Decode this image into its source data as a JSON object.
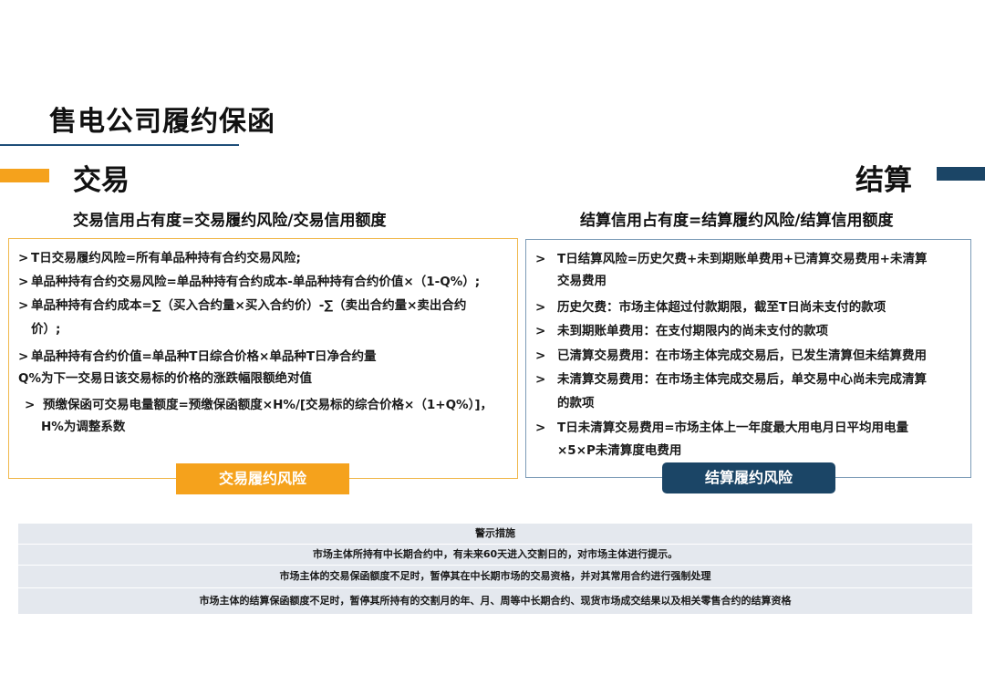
{
  "title": "售电公司履约保函",
  "left": {
    "heading": "交易",
    "formula": "交易信用占有度=交易履约风险/交易信用额度",
    "lines": [
      "T日交易履约风险=所有单品种持有合约交易风险;",
      "单品种持有合约交易风险=单品种持有合约成本-单品种持有合约价值×（1-Q%）;",
      "单品种持有合约成本=∑（买入合约量×买入合约价）-∑（卖出合约量×卖出合约",
      "价）;",
      "单品种持有合约价值=单品种T日综合价格×单品种T日净合约量",
      "Q%为下一交易日该交易标的价格的涨跌幅限额绝对值",
      "预缴保函可交易电量额度=预缴保函额度×H%/[交易标的综合价格×（1+Q%）]，",
      "H%为调整系数"
    ],
    "tag": "交易履约风险"
  },
  "right": {
    "heading": "结算",
    "formula": "结算信用占有度=结算履约风险/结算信用额度",
    "lines": [
      "T日结算风险=历史欠费+未到期账单费用+已清算交易费用+未清算",
      "交易费用",
      "历史欠费：市场主体超过付款期限，截至T日尚未支付的款项",
      "未到期账单费用：在支付期限内的尚未支付的款项",
      "已清算交易费用：在市场主体完成交易后，已发生清算但未结算费用",
      "未清算交易费用：在市场主体完成交易后，单交易中心尚未完成清算",
      "的款项",
      "T日未清算交易费用=市场主体上一年度最大用电月日平均用电量",
      "×5×P未清算度电费用"
    ],
    "tag": "结算履约风险"
  },
  "warning": {
    "header": "警示措施",
    "rows": [
      "市场主体所持有中长期合约中，有未来60天进入交割日的，对市场主体进行提示。",
      "市场主体的交易保函额度不足时，暂停其在中长期市场的交易资格，并对其常用合约进行强制处理",
      "市场主体的结算保函额度不足时，暂停其所持有的交割月的年、月、周等中长期合约、现货市场成交结果以及相关零售合约的结算资格"
    ]
  },
  "colors": {
    "accent_orange": "#f5a21c",
    "accent_navy": "#1b4566",
    "warning_bg": "#e4e8ee"
  }
}
